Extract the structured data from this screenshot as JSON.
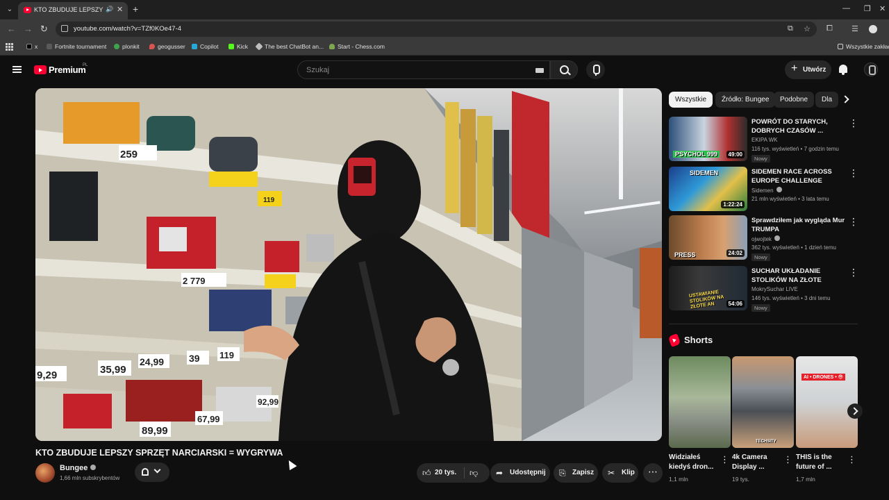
{
  "browser": {
    "tab_title": "KTO ZBUDUJE LEPSZY SPRZ",
    "url": "youtube.com/watch?v=TZf0KOe47-4",
    "bookmarks": [
      {
        "label": "x",
        "color": "#000000"
      },
      {
        "label": "Fortnite tournament",
        "color": "#5a5a5a"
      },
      {
        "label": "plonkit",
        "color": "#3fa34d"
      },
      {
        "label": "geogusser",
        "color": "#d9534f"
      },
      {
        "label": "Copilot",
        "color": "#2aa7d9"
      },
      {
        "label": "Kick",
        "color": "#53fc18"
      },
      {
        "label": "The best ChatBot an...",
        "color": "#bdbdbd"
      },
      {
        "label": "Start - Chess.com",
        "color": "#7fa650"
      }
    ],
    "bookmarks_folder": "Wszystkie zakładki"
  },
  "youtube": {
    "brand": "Premium",
    "region": "PL",
    "search_placeholder": "Szukaj",
    "create_label": "Utwórz",
    "accent": "#ff0033"
  },
  "video": {
    "title": "KTO ZBUDUJE LEPSZY SPRZĘT NARCIARSKI = WYGRYWA",
    "channel": "Bungee",
    "subscribers": "1,66 mln subskrybentów",
    "likes": "20 tys.",
    "share_label": "Udostępnij",
    "save_label": "Zapisz",
    "clip_label": "Klip",
    "price_tags": [
      "259",
      "119",
      "2 779",
      "24,99",
      "39",
      "119",
      "35,99",
      "89,99",
      "67,99",
      "92,99",
      "9,29"
    ]
  },
  "sidebar": {
    "chips": [
      "Wszystkie",
      "Źródło: Bungee",
      "Podobne",
      "Dla"
    ],
    "recommendations": [
      {
        "title": "POWRÓT DO STARYCH, DOBRYCH CZASÓW ...",
        "channel": "EKIPA WK",
        "meta": "116 tys. wyświetleń • 7 godzin temu",
        "badge": "Nowy",
        "duration": "49:00",
        "thumb_text": "PSYCHOL 999",
        "verified": false
      },
      {
        "title": "SIDEMEN RACE ACROSS EUROPE CHALLENGE",
        "channel": "Sidemen",
        "meta": "21 mln wyświetleń • 3 lata temu",
        "badge": "",
        "duration": "1:22:24",
        "thumb_text": "SIDEMEN",
        "verified": true
      },
      {
        "title": "Sprawdziłem jak wygląda Mur TRUMPA",
        "channel": "ojwojtek",
        "meta": "362 tys. wyświetleń • 1 dzień temu",
        "badge": "Nowy",
        "duration": "24:02",
        "thumb_text": "PRESS",
        "verified": true
      },
      {
        "title": "SUCHAR UKŁADANIE STOLIKÓW NA ZŁOTE ANTOSI...",
        "channel": "MokrySuchar LIVE",
        "meta": "146 tys. wyświetleń • 3 dni temu",
        "badge": "Nowy",
        "duration": "54:06",
        "thumb_text": "USTAWIANIE STOLIKÓW NA ZŁOTE AN",
        "verified": false
      }
    ],
    "shorts_heading": "Shorts",
    "shorts": [
      {
        "title": "Widziałeś kiedyś dron...",
        "views": "1,1 mln",
        "overlay": ""
      },
      {
        "title": "4k Camera Display ...",
        "views": "19 tys.",
        "overlay": "TECHSITY"
      },
      {
        "title": "THIS is the future of ...",
        "views": "1,7 mln",
        "overlay": "AI • DRONES • 😎"
      }
    ]
  }
}
